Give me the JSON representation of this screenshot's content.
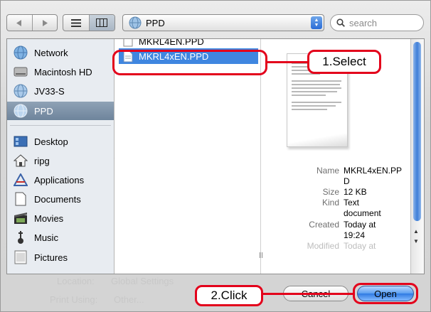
{
  "toolbar": {
    "back_icon": "back-arrow-icon",
    "forward_icon": "forward-arrow-icon",
    "list_view_icon": "list-view-icon",
    "column_view_icon": "column-view-icon",
    "location": "PPD",
    "search_placeholder": "search"
  },
  "sidebar": {
    "items": [
      {
        "label": "Network",
        "icon": "network-globe-icon",
        "selected": false
      },
      {
        "label": "Macintosh HD",
        "icon": "hard-disk-icon",
        "selected": false
      },
      {
        "label": "JV33-S",
        "icon": "network-volume-icon",
        "selected": false
      },
      {
        "label": "PPD",
        "icon": "network-volume-icon",
        "selected": true
      },
      {
        "label": "Desktop",
        "icon": "desktop-icon",
        "selected": false
      },
      {
        "label": "ripg",
        "icon": "home-icon",
        "selected": false
      },
      {
        "label": "Applications",
        "icon": "applications-icon",
        "selected": false
      },
      {
        "label": "Documents",
        "icon": "documents-icon",
        "selected": false
      },
      {
        "label": "Movies",
        "icon": "movies-icon",
        "selected": false
      },
      {
        "label": "Music",
        "icon": "music-icon",
        "selected": false
      },
      {
        "label": "Pictures",
        "icon": "pictures-icon",
        "selected": false
      }
    ]
  },
  "files": {
    "partial": "MKRL4EN.PPD",
    "selected": "MKRL4xEN.PPD"
  },
  "preview": {
    "name_label": "Name",
    "name_value": "MKRL4xEN.PPD",
    "size_label": "Size",
    "size_value": "12 KB",
    "kind_label": "Kind",
    "kind_value": "Text document",
    "created_label": "Created",
    "created_value": "Today at 19:24",
    "modified_label": "Modified",
    "modified_value": "Today at"
  },
  "bottom": {
    "location_label": "Location:",
    "location_value": "Global Settings",
    "print_using_label": "Print Using:",
    "print_using_value": "Other..."
  },
  "buttons": {
    "cancel": "Cancel",
    "open": "Open"
  },
  "callouts": {
    "select": "1.Select",
    "click": "2.Click"
  },
  "colors": {
    "callout_red": "#e3001b",
    "selection_blue": "#3f86e0",
    "sidebar_selected": "#7a8ea5",
    "open_button": "#4b90ea"
  }
}
